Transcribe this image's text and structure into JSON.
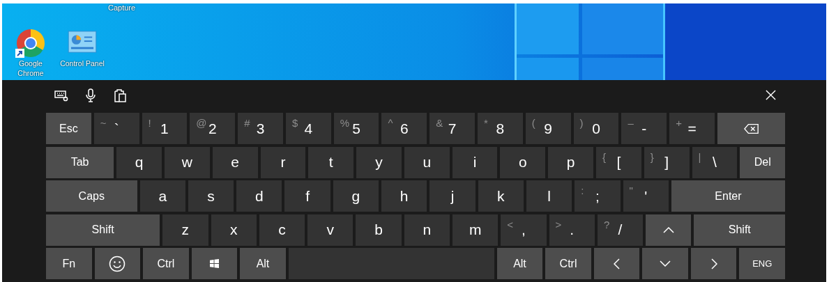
{
  "desktop": {
    "cut_label": "Capture",
    "icons": [
      {
        "label": "Google Chrome",
        "kind": "chrome"
      },
      {
        "label": "Control Panel",
        "kind": "control-panel"
      }
    ]
  },
  "keyboard": {
    "rows": [
      {
        "keys": [
          {
            "label": "Esc",
            "kind": "function"
          },
          {
            "label": "`",
            "shift": "~",
            "kind": "char"
          },
          {
            "label": "1",
            "shift": "!",
            "kind": "char"
          },
          {
            "label": "2",
            "shift": "@",
            "kind": "char"
          },
          {
            "label": "3",
            "shift": "#",
            "kind": "char"
          },
          {
            "label": "4",
            "shift": "$",
            "kind": "char"
          },
          {
            "label": "5",
            "shift": "%",
            "kind": "char"
          },
          {
            "label": "6",
            "shift": "^",
            "kind": "char"
          },
          {
            "label": "7",
            "shift": "&",
            "kind": "char"
          },
          {
            "label": "8",
            "shift": "*",
            "kind": "char"
          },
          {
            "label": "9",
            "shift": "(",
            "kind": "char"
          },
          {
            "label": "0",
            "shift": ")",
            "kind": "char"
          },
          {
            "label": "-",
            "shift": "–",
            "kind": "char"
          },
          {
            "label": "=",
            "shift": "+",
            "kind": "char"
          },
          {
            "kind": "backspace"
          }
        ]
      },
      {
        "keys": [
          {
            "label": "Tab",
            "kind": "function"
          },
          {
            "label": "q",
            "kind": "char"
          },
          {
            "label": "w",
            "kind": "char"
          },
          {
            "label": "e",
            "kind": "char"
          },
          {
            "label": "r",
            "kind": "char"
          },
          {
            "label": "t",
            "kind": "char"
          },
          {
            "label": "y",
            "kind": "char"
          },
          {
            "label": "u",
            "kind": "char"
          },
          {
            "label": "i",
            "kind": "char"
          },
          {
            "label": "o",
            "kind": "char"
          },
          {
            "label": "p",
            "kind": "char"
          },
          {
            "label": "[",
            "shift": "{",
            "kind": "char"
          },
          {
            "label": "]",
            "shift": "}",
            "kind": "char"
          },
          {
            "label": "\\",
            "shift": "|",
            "kind": "char"
          },
          {
            "label": "Del",
            "kind": "function"
          }
        ]
      },
      {
        "keys": [
          {
            "label": "Caps",
            "kind": "function"
          },
          {
            "label": "a",
            "kind": "char"
          },
          {
            "label": "s",
            "kind": "char"
          },
          {
            "label": "d",
            "kind": "char"
          },
          {
            "label": "f",
            "kind": "char"
          },
          {
            "label": "g",
            "kind": "char"
          },
          {
            "label": "h",
            "kind": "char"
          },
          {
            "label": "j",
            "kind": "char"
          },
          {
            "label": "k",
            "kind": "char"
          },
          {
            "label": "l",
            "kind": "char"
          },
          {
            "label": ";",
            "shift": ":",
            "kind": "char"
          },
          {
            "label": "'",
            "shift": "\"",
            "kind": "char"
          },
          {
            "label": "Enter",
            "kind": "function"
          }
        ]
      },
      {
        "keys": [
          {
            "label": "Shift",
            "kind": "function"
          },
          {
            "label": "z",
            "kind": "char"
          },
          {
            "label": "x",
            "kind": "char"
          },
          {
            "label": "c",
            "kind": "char"
          },
          {
            "label": "v",
            "kind": "char"
          },
          {
            "label": "b",
            "kind": "char"
          },
          {
            "label": "n",
            "kind": "char"
          },
          {
            "label": "m",
            "kind": "char"
          },
          {
            "label": ",",
            "shift": "<",
            "kind": "char"
          },
          {
            "label": ".",
            "shift": ">",
            "kind": "char"
          },
          {
            "label": "/",
            "shift": "?",
            "kind": "char"
          },
          {
            "kind": "up"
          },
          {
            "label": "Shift",
            "kind": "function"
          }
        ]
      },
      {
        "keys": [
          {
            "label": "Fn",
            "kind": "function"
          },
          {
            "kind": "emoji"
          },
          {
            "label": "Ctrl",
            "kind": "function"
          },
          {
            "kind": "windows"
          },
          {
            "label": "Alt",
            "kind": "function"
          },
          {
            "kind": "space"
          },
          {
            "label": "Alt",
            "kind": "function"
          },
          {
            "label": "Ctrl",
            "kind": "function"
          },
          {
            "kind": "left"
          },
          {
            "kind": "down"
          },
          {
            "kind": "right"
          },
          {
            "label": "ENG",
            "kind": "language"
          }
        ]
      }
    ]
  }
}
